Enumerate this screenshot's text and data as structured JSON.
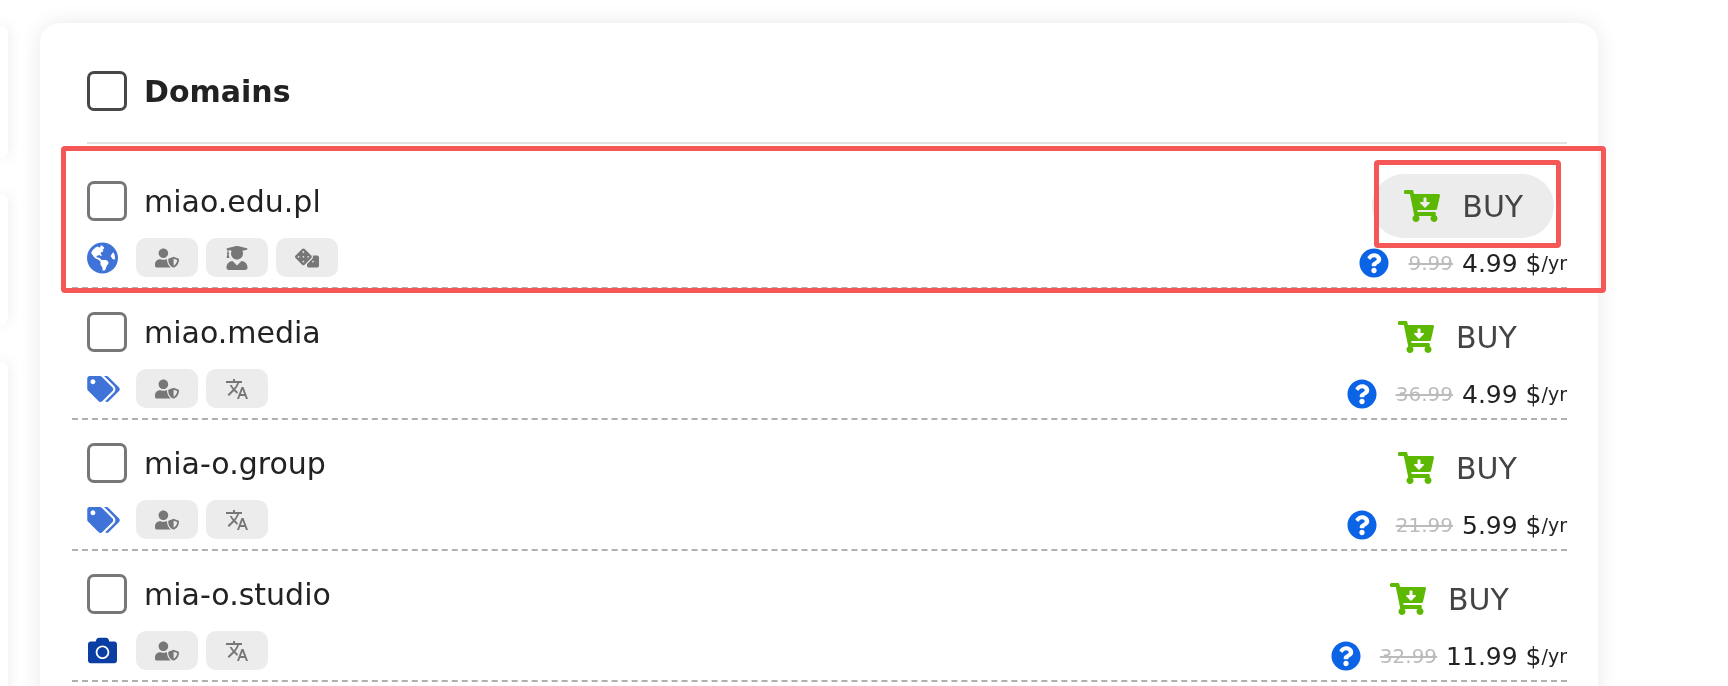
{
  "header": {
    "title": "Domains",
    "checked": false
  },
  "domains": [
    {
      "name": "miao.edu.pl",
      "checked": false,
      "highlighted": true,
      "category": {
        "kind": "globe"
      },
      "badges": [
        {
          "kind": "privacy"
        },
        {
          "kind": "education"
        },
        {
          "kind": "games"
        }
      ],
      "buy": {
        "label": "BUY",
        "hovered": true
      },
      "price": {
        "old": "9.99",
        "current": "4.99 $",
        "unit": "/yr"
      }
    },
    {
      "name": "miao.media",
      "checked": false,
      "highlighted": false,
      "category": {
        "kind": "tags"
      },
      "badges": [
        {
          "kind": "privacy"
        },
        {
          "kind": "translation"
        }
      ],
      "buy": {
        "label": "BUY",
        "hovered": false
      },
      "price": {
        "old": "36.99",
        "current": "4.99 $",
        "unit": "/yr"
      }
    },
    {
      "name": "mia-o.group",
      "checked": false,
      "highlighted": false,
      "category": {
        "kind": "tags"
      },
      "badges": [
        {
          "kind": "privacy"
        },
        {
          "kind": "translation"
        }
      ],
      "buy": {
        "label": "BUY",
        "hovered": false
      },
      "price": {
        "old": "21.99",
        "current": "5.99 $",
        "unit": "/yr"
      }
    },
    {
      "name": "mia-o.studio",
      "checked": false,
      "highlighted": false,
      "category": {
        "kind": "camera"
      },
      "badges": [
        {
          "kind": "privacy"
        },
        {
          "kind": "translation"
        }
      ],
      "buy": {
        "label": "BUY",
        "hovered": false
      },
      "price": {
        "old": "32.99",
        "current": "11.99 $",
        "unit": "/yr"
      }
    }
  ]
}
